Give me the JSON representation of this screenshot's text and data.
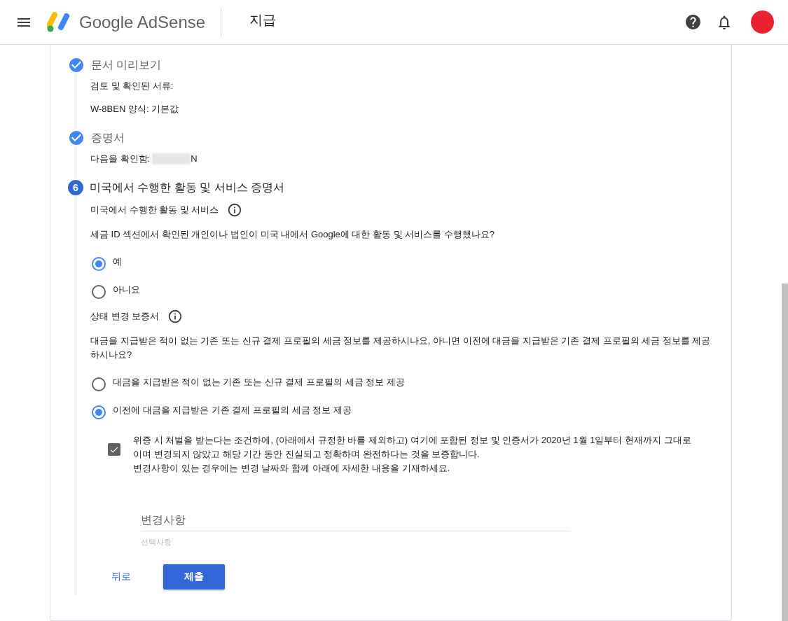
{
  "header": {
    "product": "Google AdSense",
    "page_title": "지급"
  },
  "steps": [
    {
      "kind": "done",
      "title": "문서 미리보기",
      "lines": [
        "검토 및 확인된 서류:",
        "W-8BEN 양식: 기본값"
      ]
    },
    {
      "kind": "done",
      "title": "증명서",
      "lines": [
        "다음을 확인함:"
      ],
      "redacted_value_end": "N"
    },
    {
      "kind": "active",
      "number": "6",
      "title": "미국에서 수행한 활동 및 서비스 증명서"
    }
  ],
  "form": {
    "sections": [
      {
        "title": "미국에서 수행한 활동 및 서비스",
        "question": "세금 ID 섹션에서 확인된 개인이나 법인이 미국 내에서 Google에 대한 활동 및 서비스를 수행했나요?",
        "options": [
          {
            "label": "예",
            "selected": true
          },
          {
            "label": "아니요",
            "selected": false
          }
        ]
      },
      {
        "title": "상태 변경 보증서",
        "question": "대금을 지급받은 적이 없는 기존 또는 신규 결제 프로필의 세금 정보를 제공하시나요, 아니면 이전에 대금을 지급받은 기존 결제 프로필의 세금 정보를 제공하시나요?",
        "options": [
          {
            "label": "대금을 지급받은 적이 없는 기존 또는 신규 결제 프로필의 세금 정보 제공",
            "selected": false
          },
          {
            "label": "이전에 대금을 지급받은 기존 결제 프로필의 세금 정보 제공",
            "selected": true
          }
        ]
      }
    ],
    "attestation": {
      "checked": true,
      "paragraphs": [
        "위증 시 처벌을 받는다는 조건하에, (아래에서 규정한 바를 제외하고) 여기에 포함된 정보 및 인증서가 2020년 1월 1일부터 현재까지 그대로이며 변경되지 않았고 해당 기간 동안 진실되고 정확하며 완전하다는 것을 보증합니다.",
        "변경사항이 있는 경우에는 변경 날짜와 함께 아래에 자세한 내용을 기재하세요."
      ]
    },
    "changes_field": {
      "label": "변경사항",
      "hint": "선택사항"
    },
    "back": "뒤로",
    "submit": "제출"
  }
}
